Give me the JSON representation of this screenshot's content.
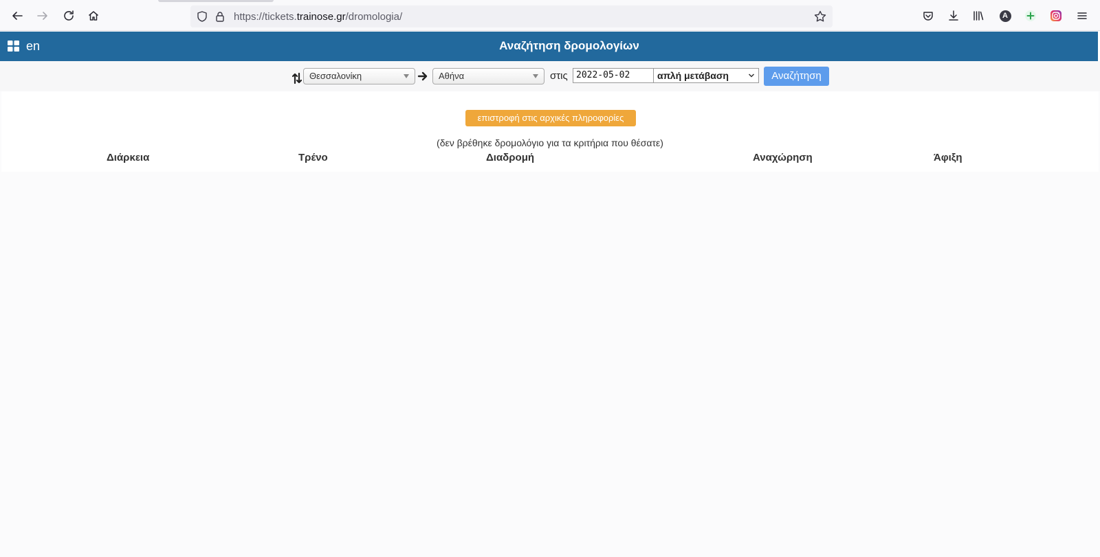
{
  "browser": {
    "url_scheme": "https://tickets.",
    "url_host": "trainose.gr",
    "url_path": "/dromologia/",
    "profile_letter": "A"
  },
  "header": {
    "lang": "en",
    "title": "Αναζήτηση δρομολογίων"
  },
  "search": {
    "from": "Θεσσαλονίκη",
    "to": "Αθήνα",
    "on_label": "στις",
    "date": "2022-05-02",
    "trip_type": "απλή μετάβαση",
    "search_label": "Αναζήτηση"
  },
  "results": {
    "back_label": "επιστροφή στις αρχικές πληροφορίες",
    "empty_message": "(δεν βρέθηκε δρομολόγιο για τα κριτήρια που θέσατε)",
    "columns": [
      "Διάρκεια",
      "Τρένο",
      "Διαδρομή",
      "Αναχώρηση",
      "Άφιξη"
    ]
  },
  "colors": {
    "header_bg": "#22699d",
    "search_btn": "#5d9cec",
    "back_btn": "#efa73a"
  }
}
